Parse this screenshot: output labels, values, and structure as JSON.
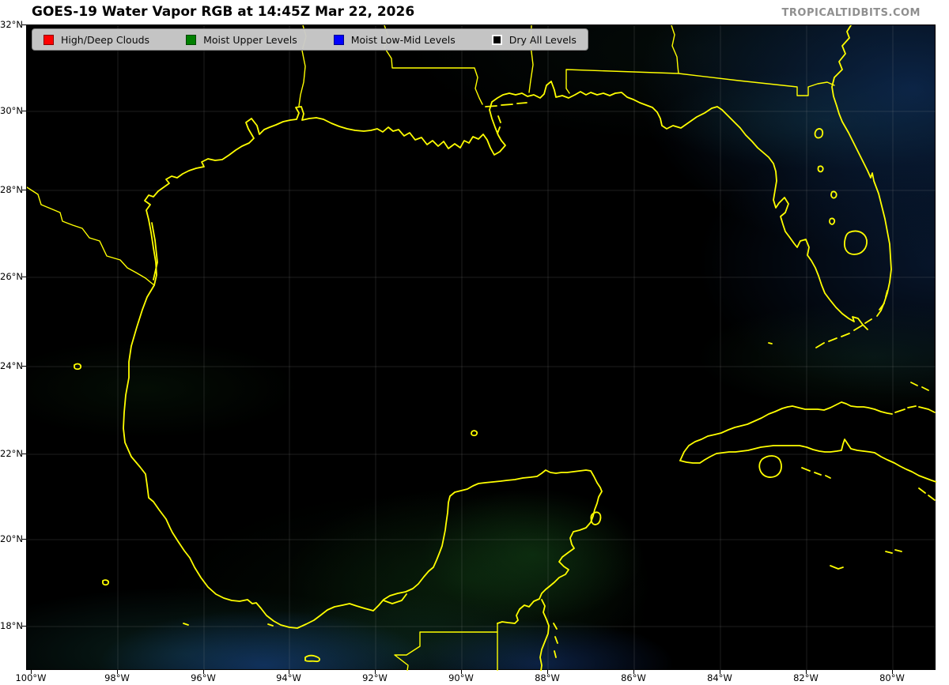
{
  "header": {
    "title": "GOES-19 Water Vapor RGB at 14:45Z Mar 22, 2026",
    "watermark": "TROPICALTIDBITS.COM"
  },
  "legend": {
    "items": [
      {
        "label": "High/Deep Clouds",
        "color": "#ff0000",
        "icon": "red-square-swatch"
      },
      {
        "label": "Moist Upper Levels",
        "color": "#008000",
        "icon": "green-square-swatch"
      },
      {
        "label": "Moist Low-Mid Levels",
        "color": "#0000ff",
        "icon": "blue-square-swatch"
      },
      {
        "label": "Dry All Levels",
        "color": "#000000",
        "icon": "black-square-swatch"
      }
    ]
  },
  "axes": {
    "lat_ticks": [
      "32°N",
      "30°N",
      "28°N",
      "26°N",
      "24°N",
      "22°N",
      "20°N",
      "18°N"
    ],
    "lon_ticks": [
      "100°W",
      "98°W",
      "96°W",
      "94°W",
      "92°W",
      "90°W",
      "88°W",
      "86°W",
      "84°W",
      "82°W",
      "80°W"
    ],
    "lat_range": [
      18,
      32
    ],
    "lon_range": [
      100,
      79
    ]
  },
  "map": {
    "type": "satellite-water-vapor-rgb",
    "region": "Gulf of Mexico",
    "coastline_color": "#ffff00",
    "dry_color": "#000000",
    "moist_upper_color": "#124016",
    "moist_lowmid_color": "#19468c",
    "atlantic_moisture_color": "#0e2c56"
  }
}
